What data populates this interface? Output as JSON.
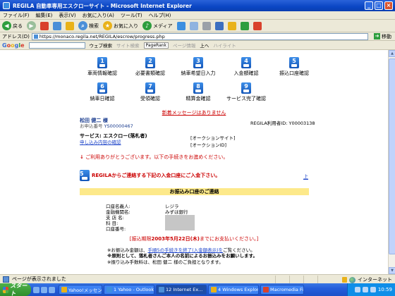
{
  "window": {
    "title": "REGILA  自動車専用エスクローサイト - Microsoft Internet Explorer"
  },
  "menu": [
    "ファイル(F)",
    "編集(E)",
    "表示(V)",
    "お気に入り(A)",
    "ツール(T)",
    "ヘルプ(H)"
  ],
  "toolbar": {
    "back": "戻る",
    "search": "検索",
    "favorites": "お気に入り",
    "media": "メディア"
  },
  "address": {
    "label": "アドレス(D)",
    "url": "https://monaco.regila.net/REGILA/escrow/progress.php",
    "go": "移動"
  },
  "googlebar": {
    "logo": [
      "G",
      "o",
      "o",
      "g",
      "l",
      "e"
    ],
    "web_search": "ウェブ検索",
    "site_search": "サイト検索",
    "pagerank": "PageRank",
    "page_info": "ページ情報",
    "up": "上へ",
    "highlight": "ハイライト"
  },
  "steps_row1": [
    {
      "num": "1",
      "label": "車両情報確認"
    },
    {
      "num": "2",
      "label": "必要書類確認"
    },
    {
      "num": "3",
      "label": "納車希望日入力"
    },
    {
      "num": "4",
      "label": "入金額確認"
    },
    {
      "num": "5",
      "label": "振込口座確認"
    }
  ],
  "steps_row2": [
    {
      "num": "6",
      "label": "納車日確認"
    },
    {
      "num": "7",
      "label": "受領確認"
    },
    {
      "num": "8",
      "label": "精算金確認"
    },
    {
      "num": "9",
      "label": "サービス完了確認"
    }
  ],
  "notice": "新着メッセージはありません",
  "user": {
    "name": "松田 健二 様",
    "num_label": "お申込番号",
    "num_value": "YS00000467",
    "member_id": "REGILA利用者ID: Y00003138"
  },
  "service": {
    "label": "サービス: エスクロー(落札者)",
    "confirm_link": "申し込み内容の確認",
    "auction_site": "[オークションサイト]",
    "auction_id": "[オークションID]"
  },
  "thanks": {
    "arrow": "↓",
    "text": "ご利用ありがとうございます。以下の手続きをお進めください。"
  },
  "step_msg": {
    "num": "5",
    "text": "REGILAからご連絡する下記の入金口座にご入金下さい。"
  },
  "page_top": "上",
  "bank": {
    "header": "お振込み口座のご連絡",
    "rows": [
      {
        "label": "口座名義人:",
        "value": "レジラ"
      },
      {
        "label": "金融機関名:",
        "value": "みずほ銀行"
      },
      {
        "label": "支 店 名:",
        "value": ""
      },
      {
        "label": "科     目:",
        "value": ""
      },
      {
        "label": "口座番号:",
        "value": ""
      }
    ]
  },
  "deadline": {
    "prefix": "[振込期限",
    "date": "2003年5月22日(木)",
    "suffix": "までにお支払いください。]"
  },
  "notes": {
    "n1_a": "※お振込み金額は、",
    "n1_link": "手順5の手続きを終了(入金額表示)を",
    "n1_b": "ご覧ください。",
    "n2": "※原則として、落札者さんご本人の名前によるお振込みをお願いします。",
    "n3": "※振り込み手数料は、松田 健二 様のご負担となります。"
  },
  "status": {
    "text": "ページが表示されました",
    "zone": "インターネット"
  },
  "taskbar": {
    "start": "スタート",
    "tasks": [
      "Yahoo!メッセンジャー",
      "1 Yahoo - Outlook ...",
      "12 Internet Ex...",
      "4 Windows Explor...",
      "Macromedia Firew..."
    ],
    "clock": "10:59"
  }
}
